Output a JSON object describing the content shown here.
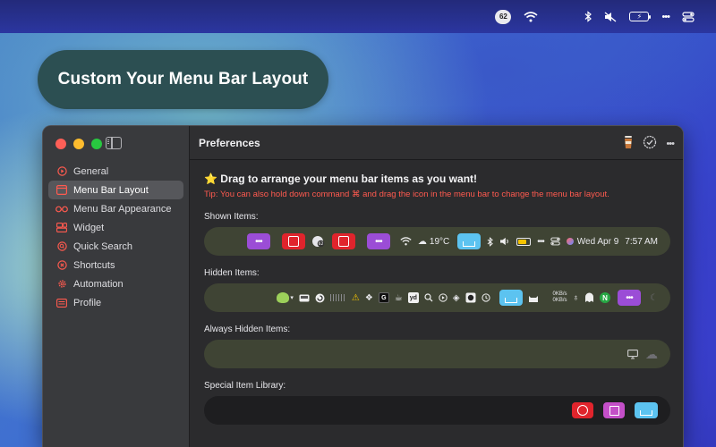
{
  "topbar": {
    "badge": "62",
    "battery": "⚡"
  },
  "promo": {
    "title": "Custom Your Menu Bar Layout"
  },
  "window": {
    "title": "Preferences",
    "sidebar": {
      "items": [
        {
          "label": "General",
          "icon": "play-circle-icon",
          "active": false
        },
        {
          "label": "Menu Bar Layout",
          "icon": "layout-icon",
          "active": true
        },
        {
          "label": "Menu Bar Appearance",
          "icon": "glasses-icon",
          "active": false
        },
        {
          "label": "Widget",
          "icon": "widget-icon",
          "active": false
        },
        {
          "label": "Quick Search",
          "icon": "search-circle-icon",
          "active": false
        },
        {
          "label": "Shortcuts",
          "icon": "shortcut-icon",
          "active": false
        },
        {
          "label": "Automation",
          "icon": "gear-icon",
          "active": false
        },
        {
          "label": "Profile",
          "icon": "profile-card-icon",
          "active": false
        }
      ]
    },
    "content": {
      "headline": "⭐ Drag to arrange your menu bar items as you want!",
      "tip": "Tip: You can also hold down command ⌘ and drag the icon in the menu bar to change the menu bar layout.",
      "shown_label": "Shown Items:",
      "hidden_label": "Hidden Items:",
      "always_hidden_label": "Always Hidden Items:",
      "library_label": "Special Item Library:",
      "shown": {
        "weather": "19°C",
        "date": "Wed Apr 9",
        "time": "7:57 AM",
        "dots": "•••"
      },
      "hidden": {
        "net_up": "0KB/s",
        "net_down": "0KB/s",
        "yd": "yd",
        "n": "N",
        "dots": "•••"
      }
    }
  },
  "colors": {
    "accent_red": "#ff5a4f",
    "purple": "#9b4dd6",
    "red": "#e0242c",
    "blue": "#5cc3f0",
    "pink": "#c44fc8"
  }
}
